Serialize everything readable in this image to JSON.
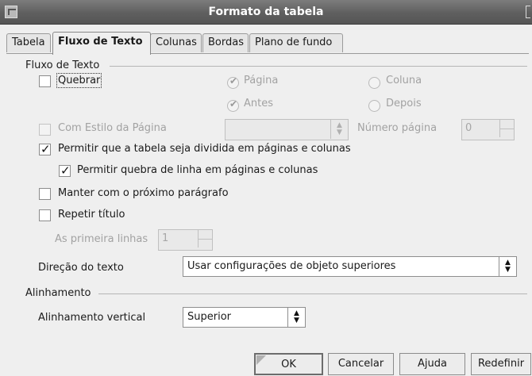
{
  "window": {
    "title": "Formato da tabela"
  },
  "tabs": [
    {
      "label": "Tabela",
      "active": false
    },
    {
      "label": "Fluxo de Texto",
      "active": true
    },
    {
      "label": "Colunas",
      "active": false
    },
    {
      "label": "Bordas",
      "active": false
    },
    {
      "label": "Plano de fundo",
      "active": false
    }
  ],
  "text_flow": {
    "section_label": "Fluxo de Texto",
    "break_checkbox": {
      "label": "Quebrar",
      "checked": false
    },
    "type_options": [
      {
        "label": "Página",
        "selected": true,
        "enabled": false
      },
      {
        "label": "Coluna",
        "selected": false,
        "enabled": false
      }
    ],
    "position_options": [
      {
        "label": "Antes",
        "selected": true,
        "enabled": false
      },
      {
        "label": "Depois",
        "selected": false,
        "enabled": false
      }
    ],
    "with_page_style": {
      "label": "Com Estilo da Página",
      "checked": false,
      "enabled": false,
      "value": ""
    },
    "page_number": {
      "label": "Número página",
      "value": "0"
    },
    "allow_split": {
      "label": "Permitir que a tabela seja dividida em páginas e colunas",
      "checked": true
    },
    "allow_row_break": {
      "label": "Permitir quebra de linha em páginas e colunas",
      "checked": true
    },
    "keep_with_next": {
      "label": "Manter com o próximo parágrafo",
      "checked": false
    },
    "repeat_heading": {
      "label": "Repetir título",
      "checked": false
    },
    "first_rows": {
      "label": "As primeira linhas",
      "value": "1"
    },
    "text_direction": {
      "label": "Direção do texto",
      "value": "Usar configurações de objeto superiores"
    }
  },
  "alignment": {
    "section_label": "Alinhamento",
    "vertical": {
      "label": "Alinhamento vertical",
      "value": "Superior"
    }
  },
  "buttons": {
    "ok": "OK",
    "cancel": "Cancelar",
    "help": "Ajuda",
    "reset": "Redefinir"
  }
}
